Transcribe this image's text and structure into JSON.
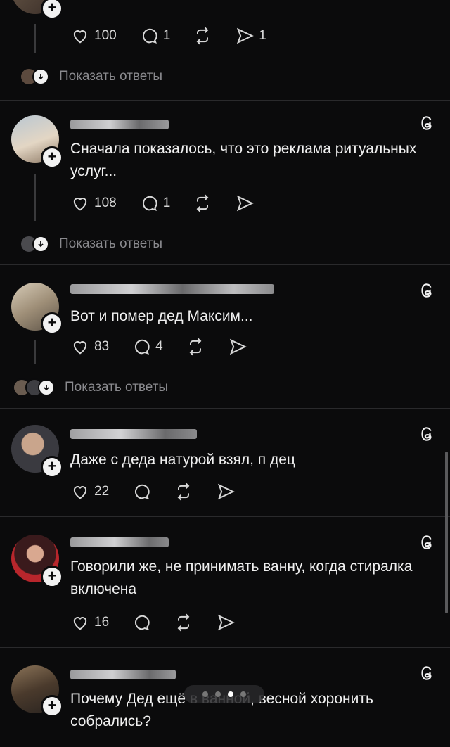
{
  "posts": [
    {
      "likes": "100",
      "replies_count": "1",
      "shares": "1",
      "show_replies": "Показать ответы"
    },
    {
      "text": "Сначала показалось, что это реклама ритуальных услуг...",
      "likes": "108",
      "replies_count": "1",
      "show_replies": "Показать ответы"
    },
    {
      "text": "Вот и помер дед Максим...",
      "likes": "83",
      "replies_count": "4",
      "show_replies": "Показать ответы"
    },
    {
      "text": "Даже с деда натурой взял, п  дец",
      "likes": "22"
    },
    {
      "text": "Говорили же, не принимать ванну, когда стиралка включена",
      "likes": "16"
    },
    {
      "text": "Почему Дед ещё в ванной, весной хоронить собрались?"
    }
  ],
  "icons": {
    "like": "heart-icon",
    "reply": "comment-icon",
    "repost": "repost-icon",
    "share": "send-icon",
    "threads": "threads-logo-icon",
    "plus": "plus-icon",
    "down": "arrow-down-icon"
  },
  "colors": {
    "background": "#0b0b0c",
    "text": "#f2f2f2",
    "muted": "#8a8a8e",
    "separator": "#2a2a2c"
  },
  "page_indicator": {
    "count": 4,
    "active": 2
  }
}
